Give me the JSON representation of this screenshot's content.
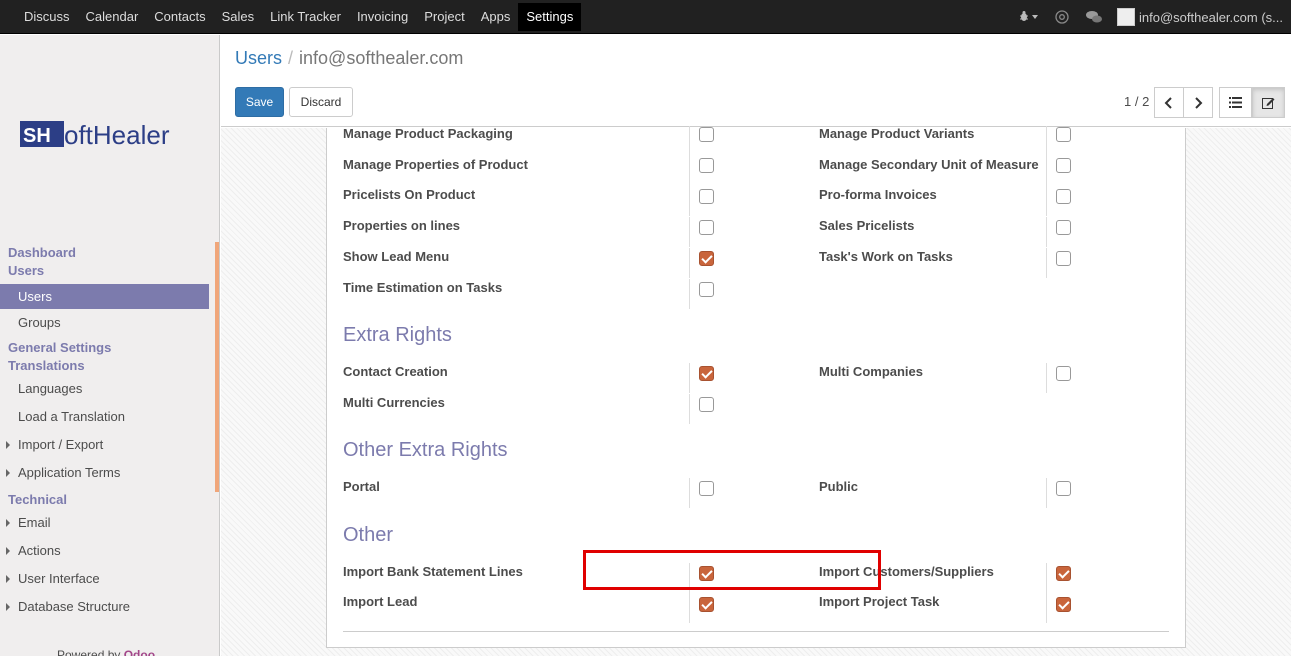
{
  "topnav": {
    "menu": [
      "Discuss",
      "Calendar",
      "Contacts",
      "Sales",
      "Link Tracker",
      "Invoicing",
      "Project",
      "Apps",
      "Settings"
    ],
    "active": "Settings",
    "user": "info@softhealer.com (s..."
  },
  "logo": {
    "text": "SoftHealer"
  },
  "sidebar": {
    "sections": [
      {
        "title": "Dashboard"
      },
      {
        "title": "Users",
        "items": [
          {
            "label": "Users",
            "active": true
          },
          {
            "label": "Groups"
          }
        ]
      },
      {
        "title": "General Settings"
      },
      {
        "title": "Translations",
        "items": [
          {
            "label": "Languages"
          },
          {
            "label": "Load a Translation"
          },
          {
            "label": "Import / Export",
            "caret": true
          },
          {
            "label": "Application Terms",
            "caret": true
          }
        ]
      },
      {
        "title": "Technical",
        "items": [
          {
            "label": "Email",
            "caret": true
          },
          {
            "label": "Actions",
            "caret": true
          },
          {
            "label": "User Interface",
            "caret": true
          },
          {
            "label": "Database Structure",
            "caret": true
          }
        ]
      }
    ],
    "powered_prefix": "Powered by",
    "powered_brand": "Odoo"
  },
  "control": {
    "breadcrumb_parent": "Users",
    "breadcrumb_sep": "/",
    "breadcrumb_current": "info@softhealer.com",
    "save_label": "Save",
    "discard_label": "Discard",
    "pager": "1 / 2"
  },
  "rights": {
    "rows1": [
      {
        "left": "Manage Product Packaging",
        "left_checked": false,
        "right": "Manage Product Variants",
        "right_checked": false
      },
      {
        "left": "Manage Properties of Product",
        "left_checked": false,
        "right": "Manage Secondary Unit of Measure",
        "right_checked": false
      },
      {
        "left": "Pricelists On Product",
        "left_checked": false,
        "right": "Pro-forma Invoices",
        "right_checked": false
      },
      {
        "left": "Properties on lines",
        "left_checked": false,
        "right": "Sales Pricelists",
        "right_checked": false
      },
      {
        "left": "Show Lead Menu",
        "left_checked": true,
        "right": "Task's Work on Tasks",
        "right_checked": false
      },
      {
        "left": "Time Estimation on Tasks",
        "left_checked": false
      }
    ],
    "extra_title": "Extra Rights",
    "extra": [
      {
        "left": "Contact Creation",
        "left_checked": true,
        "right": "Multi Companies",
        "right_checked": false
      },
      {
        "left": "Multi Currencies",
        "left_checked": false
      }
    ],
    "other_extra_title": "Other Extra Rights",
    "other_extra": [
      {
        "left": "Portal",
        "left_checked": false,
        "right": "Public",
        "right_checked": false
      }
    ],
    "other_title": "Other",
    "other": [
      {
        "left": "Import Bank Statement Lines",
        "left_checked": true,
        "right": "Import Customers/Suppliers",
        "right_checked": true
      },
      {
        "left": "Import Lead",
        "left_checked": true,
        "right": "Import Project Task",
        "right_checked": true
      }
    ]
  }
}
